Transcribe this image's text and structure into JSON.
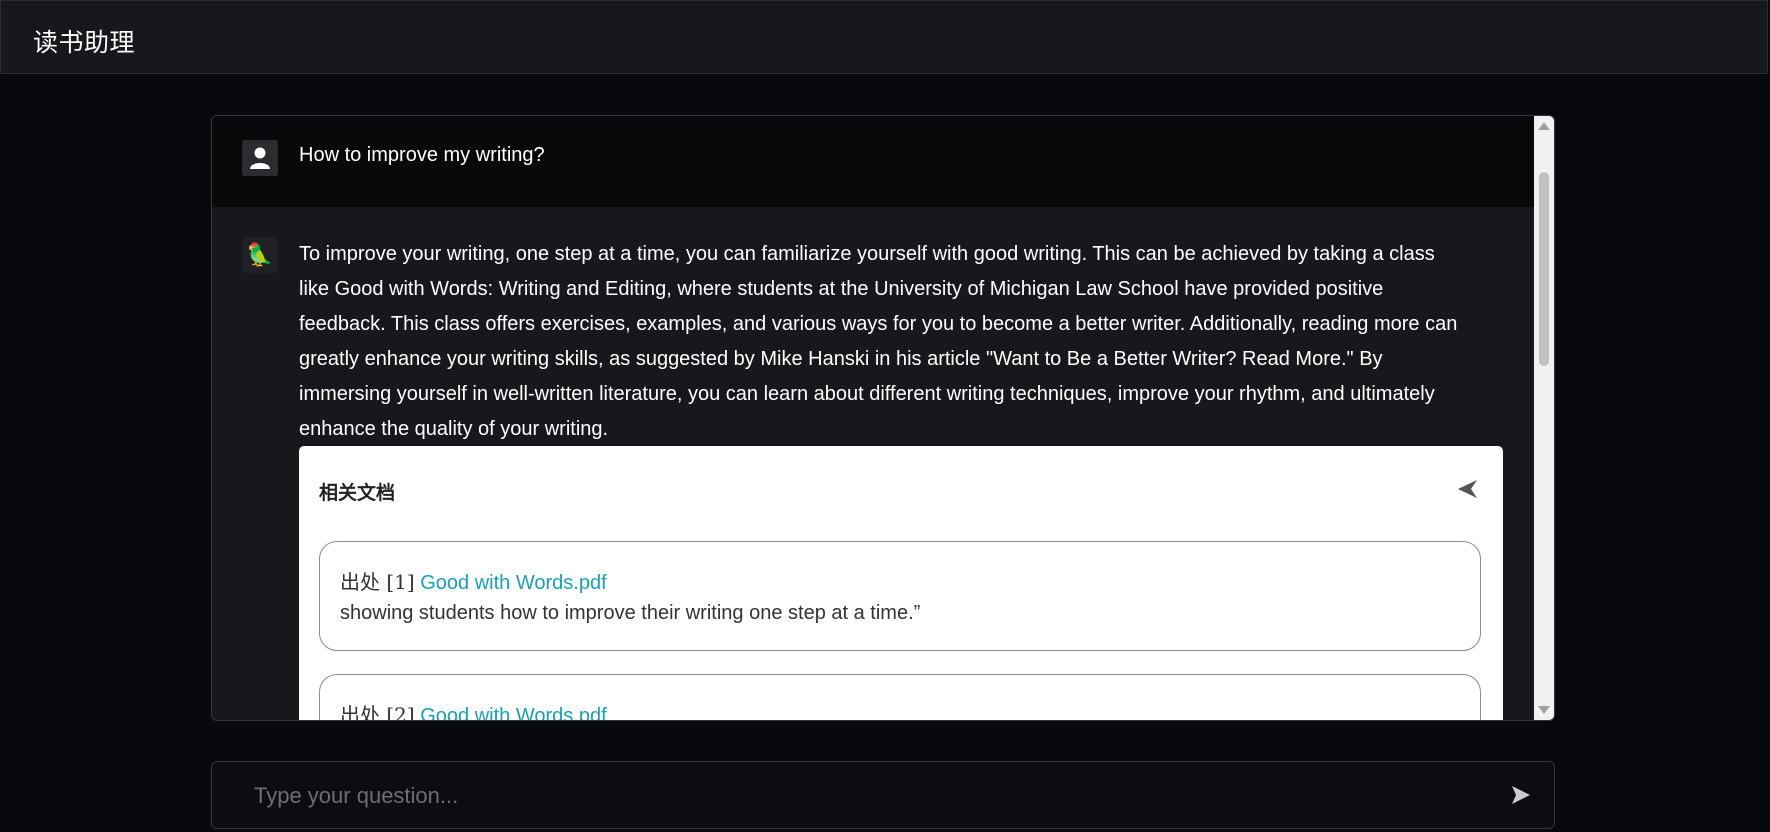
{
  "app": {
    "title": "读书助理"
  },
  "chat": {
    "user_message": "How to improve my writing?",
    "assistant_avatar": "🦜",
    "assistant_message": "To improve your writing, one step at a time, you can familiarize yourself with good writing. This can be achieved by taking a class like Good with Words: Writing and Editing, where students at the University of Michigan Law School have provided positive feedback. This class offers exercises, examples, and various ways for you to become a better writer. Additionally, reading more can greatly enhance your writing skills, as suggested by Mike Hanski in his article \"Want to Be a Better Writer? Read More.\" By immersing yourself in well-written literature, you can learn about different writing techniques, improve your rhythm, and ultimately enhance the quality of your writing."
  },
  "docs": {
    "title": "相关文档",
    "sources": [
      {
        "prefix": "出处 [1]",
        "link": "Good with Words.pdf",
        "snippet": "showing students how to improve their writing one step at a time.”"
      },
      {
        "prefix": "出处 [2]",
        "link": "Good with Words.pdf",
        "snippet": ""
      }
    ]
  },
  "input": {
    "placeholder": "Type your question..."
  },
  "icons": {
    "user": "user-icon",
    "assistant": "parrot-icon",
    "collapse": "collapse-triangle-icon",
    "send": "send-icon"
  },
  "colors": {
    "background": "#07090c",
    "link": "#17a2b8"
  }
}
